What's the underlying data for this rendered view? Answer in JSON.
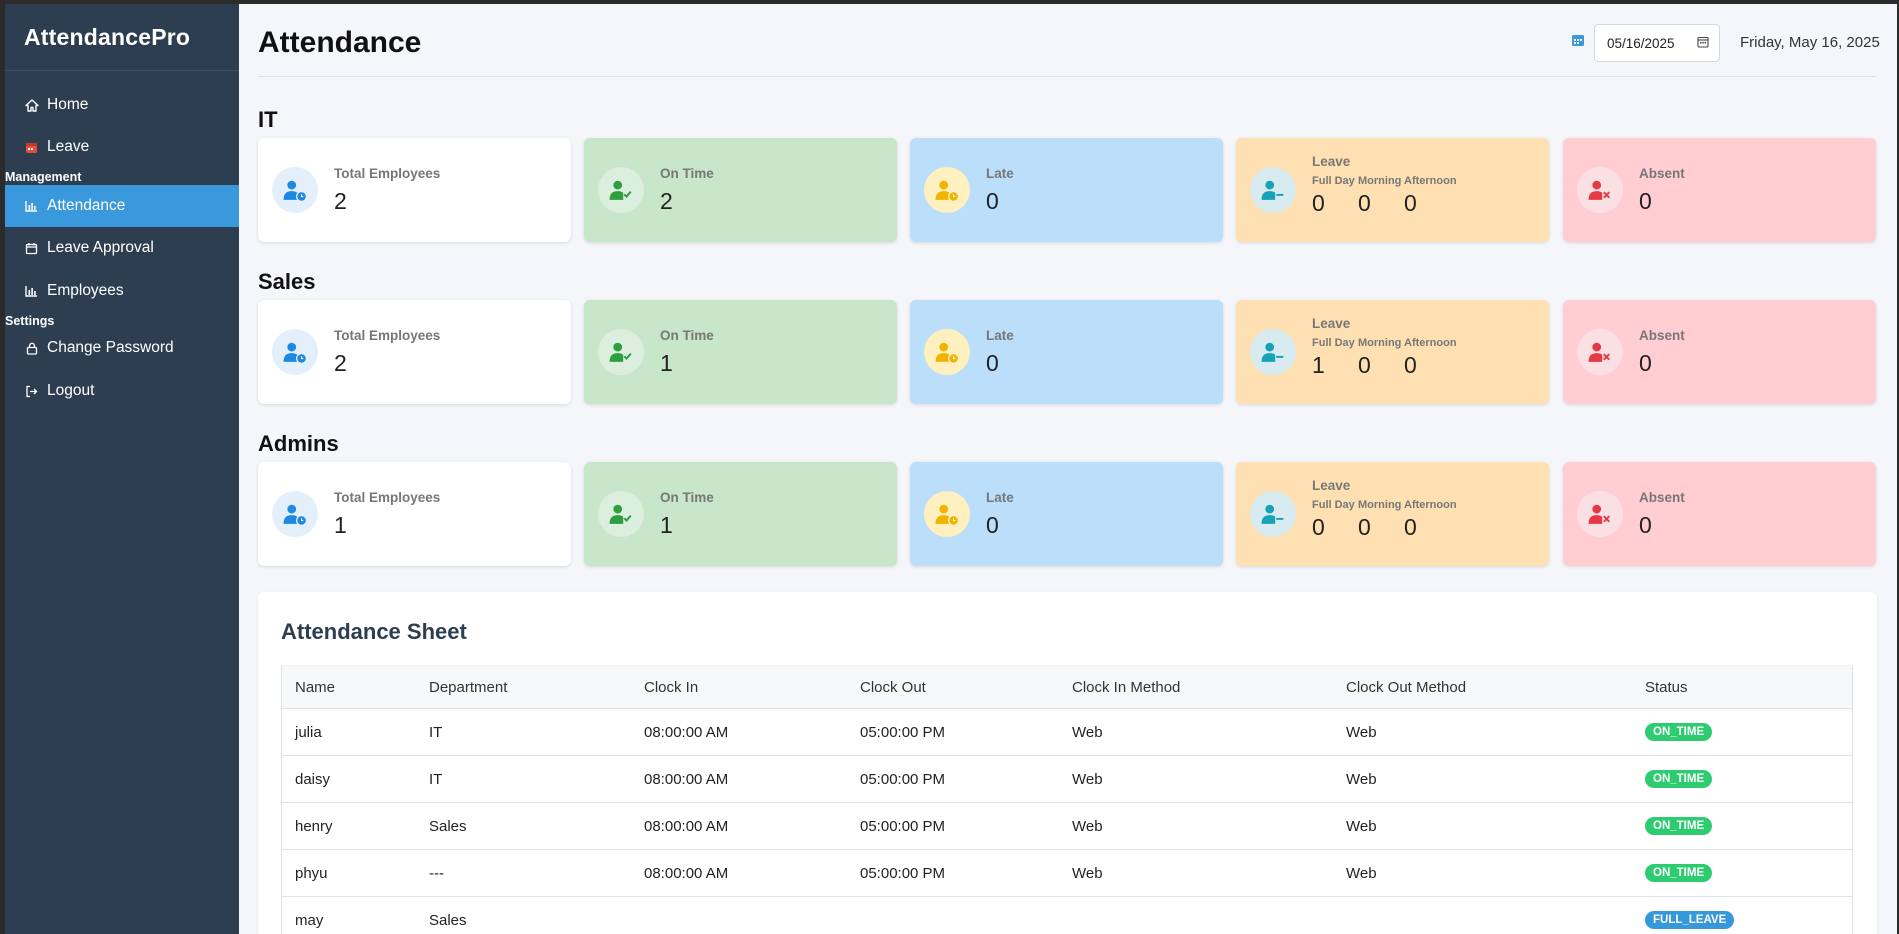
{
  "app": {
    "brand": "AttendancePro"
  },
  "sidebar": {
    "items": [
      {
        "label": "Home",
        "icon": "home-icon"
      },
      {
        "label": "Leave",
        "icon": "calendar-icon"
      }
    ],
    "management_label": "Management",
    "management_items": [
      {
        "label": "Attendance",
        "icon": "chart-icon",
        "active": true
      },
      {
        "label": "Leave Approval",
        "icon": "calendar-check-icon"
      },
      {
        "label": "Employees",
        "icon": "chart-icon"
      }
    ],
    "settings_label": "Settings",
    "settings_items": [
      {
        "label": "Change Password",
        "icon": "lock-icon"
      },
      {
        "label": "Logout",
        "icon": "logout-icon"
      }
    ]
  },
  "header": {
    "title": "Attendance",
    "date_value": "05/16/2025",
    "date_long": "Friday, May 16, 2025"
  },
  "labels": {
    "total": "Total Employees",
    "on_time": "On Time",
    "late": "Late",
    "leave": "Leave",
    "full_day": "Full Day",
    "morning": "Morning",
    "afternoon": "Afternoon",
    "absent": "Absent"
  },
  "departments": [
    {
      "name": "IT",
      "total": "2",
      "on_time": "2",
      "late": "0",
      "leave_full": "0",
      "leave_morning": "0",
      "leave_afternoon": "0",
      "absent": "0"
    },
    {
      "name": "Sales",
      "total": "2",
      "on_time": "1",
      "late": "0",
      "leave_full": "1",
      "leave_morning": "0",
      "leave_afternoon": "0",
      "absent": "0"
    },
    {
      "name": "Admins",
      "total": "1",
      "on_time": "1",
      "late": "0",
      "leave_full": "0",
      "leave_morning": "0",
      "leave_afternoon": "0",
      "absent": "0"
    }
  ],
  "sheet": {
    "title": "Attendance Sheet",
    "columns": [
      "Name",
      "Department",
      "Clock In",
      "Clock Out",
      "Clock In Method",
      "Clock Out Method",
      "Status"
    ],
    "rows": [
      [
        "julia",
        "IT",
        "08:00:00 AM",
        "05:00:00 PM",
        "Web",
        "Web",
        "ON_TIME"
      ],
      [
        "daisy",
        "IT",
        "08:00:00 AM",
        "05:00:00 PM",
        "Web",
        "Web",
        "ON_TIME"
      ],
      [
        "henry",
        "Sales",
        "08:00:00 AM",
        "05:00:00 PM",
        "Web",
        "Web",
        "ON_TIME"
      ],
      [
        "phyu",
        "---",
        "08:00:00 AM",
        "05:00:00 PM",
        "Web",
        "Web",
        "ON_TIME"
      ],
      [
        "may",
        "Sales",
        "",
        "",
        "",
        "",
        "FULL_LEAVE"
      ]
    ]
  },
  "colors": {
    "sidebar_bg": "#2d3e50",
    "active": "#3a99dc",
    "on_time_badge": "#2ecc71",
    "full_leave_badge": "#3498db"
  }
}
